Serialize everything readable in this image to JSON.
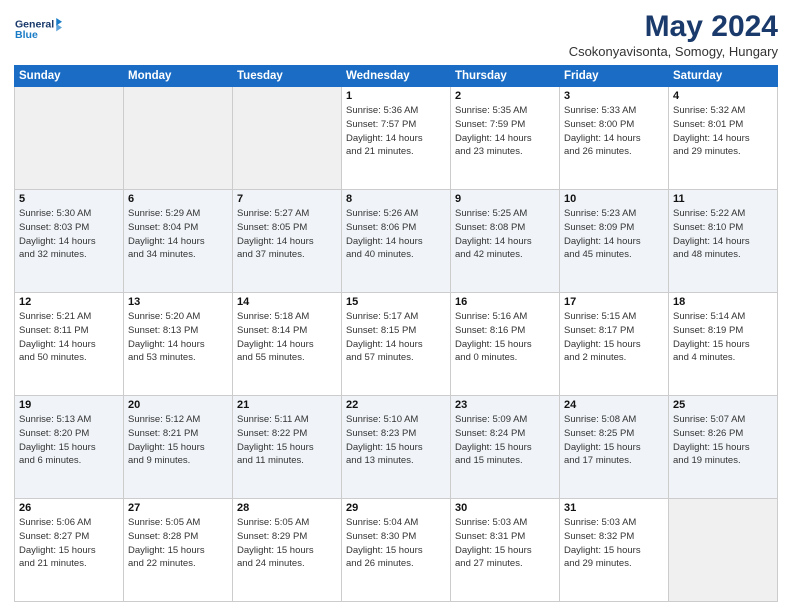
{
  "header": {
    "logo_line1": "General",
    "logo_line2": "Blue",
    "month": "May 2024",
    "location": "Csokonyavisonta, Somogy, Hungary"
  },
  "weekdays": [
    "Sunday",
    "Monday",
    "Tuesday",
    "Wednesday",
    "Thursday",
    "Friday",
    "Saturday"
  ],
  "weeks": [
    [
      {
        "day": "",
        "info": ""
      },
      {
        "day": "",
        "info": ""
      },
      {
        "day": "",
        "info": ""
      },
      {
        "day": "1",
        "info": "Sunrise: 5:36 AM\nSunset: 7:57 PM\nDaylight: 14 hours\nand 21 minutes."
      },
      {
        "day": "2",
        "info": "Sunrise: 5:35 AM\nSunset: 7:59 PM\nDaylight: 14 hours\nand 23 minutes."
      },
      {
        "day": "3",
        "info": "Sunrise: 5:33 AM\nSunset: 8:00 PM\nDaylight: 14 hours\nand 26 minutes."
      },
      {
        "day": "4",
        "info": "Sunrise: 5:32 AM\nSunset: 8:01 PM\nDaylight: 14 hours\nand 29 minutes."
      }
    ],
    [
      {
        "day": "5",
        "info": "Sunrise: 5:30 AM\nSunset: 8:03 PM\nDaylight: 14 hours\nand 32 minutes."
      },
      {
        "day": "6",
        "info": "Sunrise: 5:29 AM\nSunset: 8:04 PM\nDaylight: 14 hours\nand 34 minutes."
      },
      {
        "day": "7",
        "info": "Sunrise: 5:27 AM\nSunset: 8:05 PM\nDaylight: 14 hours\nand 37 minutes."
      },
      {
        "day": "8",
        "info": "Sunrise: 5:26 AM\nSunset: 8:06 PM\nDaylight: 14 hours\nand 40 minutes."
      },
      {
        "day": "9",
        "info": "Sunrise: 5:25 AM\nSunset: 8:08 PM\nDaylight: 14 hours\nand 42 minutes."
      },
      {
        "day": "10",
        "info": "Sunrise: 5:23 AM\nSunset: 8:09 PM\nDaylight: 14 hours\nand 45 minutes."
      },
      {
        "day": "11",
        "info": "Sunrise: 5:22 AM\nSunset: 8:10 PM\nDaylight: 14 hours\nand 48 minutes."
      }
    ],
    [
      {
        "day": "12",
        "info": "Sunrise: 5:21 AM\nSunset: 8:11 PM\nDaylight: 14 hours\nand 50 minutes."
      },
      {
        "day": "13",
        "info": "Sunrise: 5:20 AM\nSunset: 8:13 PM\nDaylight: 14 hours\nand 53 minutes."
      },
      {
        "day": "14",
        "info": "Sunrise: 5:18 AM\nSunset: 8:14 PM\nDaylight: 14 hours\nand 55 minutes."
      },
      {
        "day": "15",
        "info": "Sunrise: 5:17 AM\nSunset: 8:15 PM\nDaylight: 14 hours\nand 57 minutes."
      },
      {
        "day": "16",
        "info": "Sunrise: 5:16 AM\nSunset: 8:16 PM\nDaylight: 15 hours\nand 0 minutes."
      },
      {
        "day": "17",
        "info": "Sunrise: 5:15 AM\nSunset: 8:17 PM\nDaylight: 15 hours\nand 2 minutes."
      },
      {
        "day": "18",
        "info": "Sunrise: 5:14 AM\nSunset: 8:19 PM\nDaylight: 15 hours\nand 4 minutes."
      }
    ],
    [
      {
        "day": "19",
        "info": "Sunrise: 5:13 AM\nSunset: 8:20 PM\nDaylight: 15 hours\nand 6 minutes."
      },
      {
        "day": "20",
        "info": "Sunrise: 5:12 AM\nSunset: 8:21 PM\nDaylight: 15 hours\nand 9 minutes."
      },
      {
        "day": "21",
        "info": "Sunrise: 5:11 AM\nSunset: 8:22 PM\nDaylight: 15 hours\nand 11 minutes."
      },
      {
        "day": "22",
        "info": "Sunrise: 5:10 AM\nSunset: 8:23 PM\nDaylight: 15 hours\nand 13 minutes."
      },
      {
        "day": "23",
        "info": "Sunrise: 5:09 AM\nSunset: 8:24 PM\nDaylight: 15 hours\nand 15 minutes."
      },
      {
        "day": "24",
        "info": "Sunrise: 5:08 AM\nSunset: 8:25 PM\nDaylight: 15 hours\nand 17 minutes."
      },
      {
        "day": "25",
        "info": "Sunrise: 5:07 AM\nSunset: 8:26 PM\nDaylight: 15 hours\nand 19 minutes."
      }
    ],
    [
      {
        "day": "26",
        "info": "Sunrise: 5:06 AM\nSunset: 8:27 PM\nDaylight: 15 hours\nand 21 minutes."
      },
      {
        "day": "27",
        "info": "Sunrise: 5:05 AM\nSunset: 8:28 PM\nDaylight: 15 hours\nand 22 minutes."
      },
      {
        "day": "28",
        "info": "Sunrise: 5:05 AM\nSunset: 8:29 PM\nDaylight: 15 hours\nand 24 minutes."
      },
      {
        "day": "29",
        "info": "Sunrise: 5:04 AM\nSunset: 8:30 PM\nDaylight: 15 hours\nand 26 minutes."
      },
      {
        "day": "30",
        "info": "Sunrise: 5:03 AM\nSunset: 8:31 PM\nDaylight: 15 hours\nand 27 minutes."
      },
      {
        "day": "31",
        "info": "Sunrise: 5:03 AM\nSunset: 8:32 PM\nDaylight: 15 hours\nand 29 minutes."
      },
      {
        "day": "",
        "info": ""
      }
    ]
  ]
}
